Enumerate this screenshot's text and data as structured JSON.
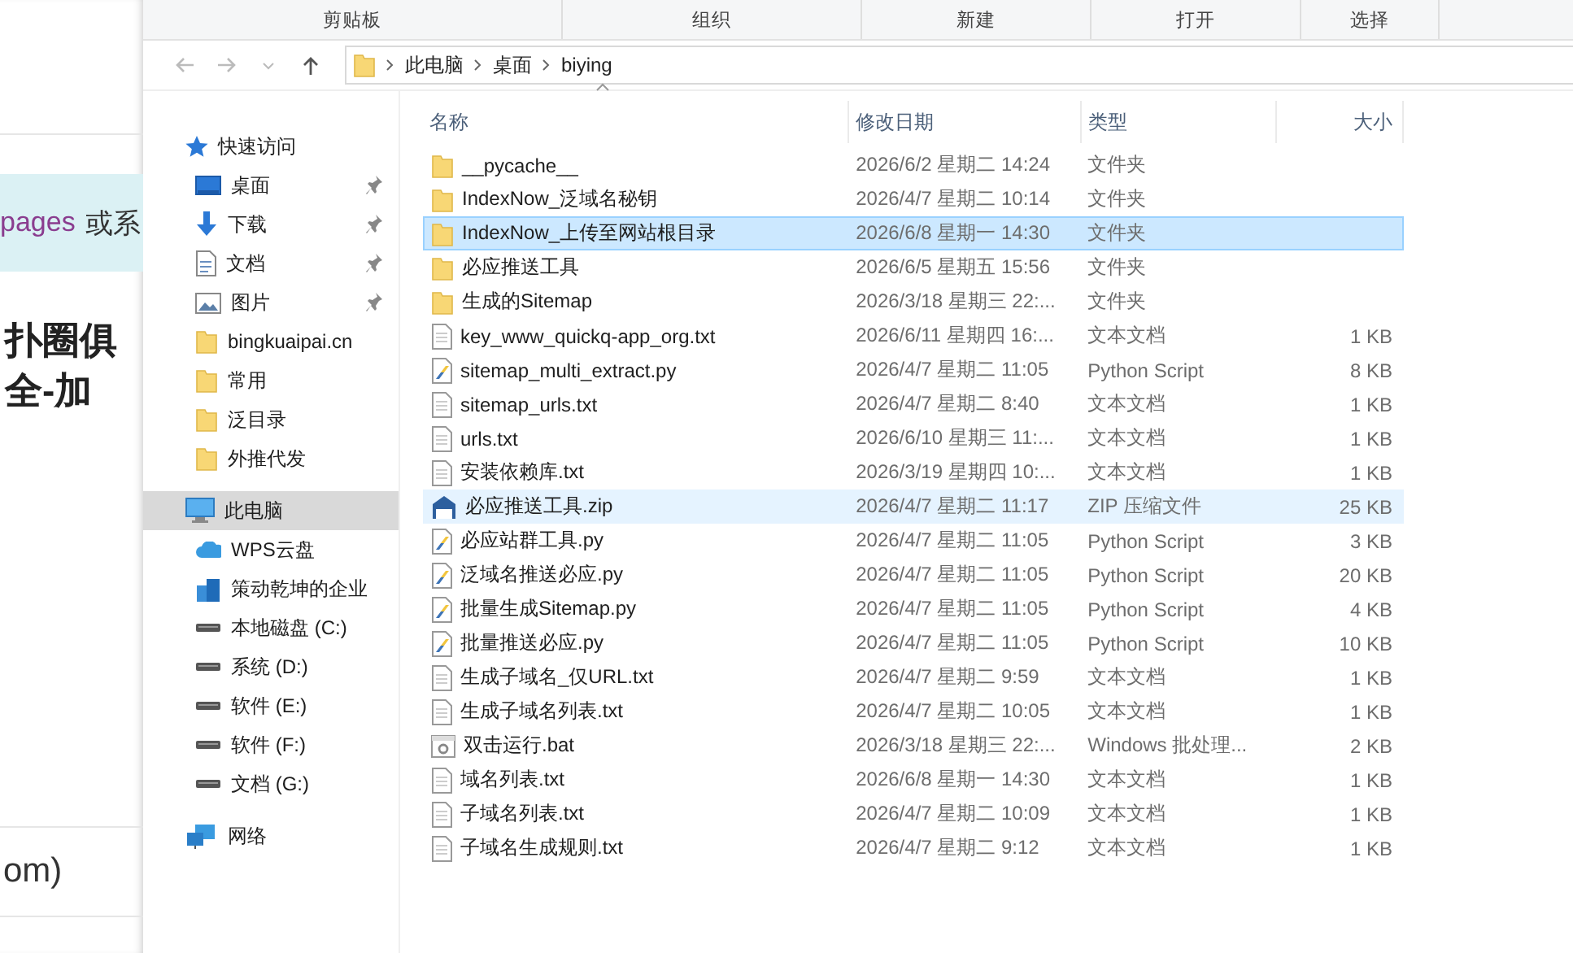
{
  "background_page": {
    "highlight_link": "pages",
    "highlight_text": "或系",
    "heading_lines": [
      "扑圈俱",
      "全-加"
    ],
    "footer_text": "om)"
  },
  "ribbon_groups": [
    "剪贴板",
    "组织",
    "新建",
    "打开",
    "选择"
  ],
  "address": {
    "crumbs": [
      "此电脑",
      "桌面",
      "biying"
    ]
  },
  "columns": [
    "名称",
    "修改日期",
    "类型",
    "大小"
  ],
  "nav": [
    {
      "kind": "star",
      "label": "快速访问",
      "selected": false,
      "pinned": false,
      "children": [
        {
          "kind": "desktop",
          "label": "桌面",
          "selected": false,
          "pinned": true
        },
        {
          "kind": "download",
          "label": "下载",
          "selected": false,
          "pinned": true
        },
        {
          "kind": "doc",
          "label": "文档",
          "selected": false,
          "pinned": true
        },
        {
          "kind": "picture",
          "label": "图片",
          "selected": false,
          "pinned": true
        },
        {
          "kind": "folder",
          "label": "bingkuaipai.cn",
          "selected": false,
          "pinned": false
        },
        {
          "kind": "folder",
          "label": "常用",
          "selected": false,
          "pinned": false
        },
        {
          "kind": "folder",
          "label": "泛目录",
          "selected": false,
          "pinned": false
        },
        {
          "kind": "folder",
          "label": "外推代发",
          "selected": false,
          "pinned": false
        }
      ]
    },
    {
      "kind": "pc",
      "label": "此电脑",
      "selected": true,
      "pinned": false,
      "children": [
        {
          "kind": "cloud",
          "label": "WPS云盘",
          "selected": false,
          "pinned": false
        },
        {
          "kind": "org",
          "label": "策动乾坤的企业",
          "selected": false,
          "pinned": false
        },
        {
          "kind": "drive",
          "label": "本地磁盘 (C:)",
          "selected": false,
          "pinned": false
        },
        {
          "kind": "drive",
          "label": "系统 (D:)",
          "selected": false,
          "pinned": false
        },
        {
          "kind": "drive",
          "label": "软件 (E:)",
          "selected": false,
          "pinned": false
        },
        {
          "kind": "drive",
          "label": "软件 (F:)",
          "selected": false,
          "pinned": false
        },
        {
          "kind": "drive",
          "label": "文档 (G:)",
          "selected": false,
          "pinned": false
        }
      ]
    },
    {
      "kind": "network",
      "label": "网络",
      "selected": false,
      "pinned": false
    }
  ],
  "files": [
    {
      "kind": "folder",
      "name": "__pycache__",
      "date": "2026/6/2 星期二 14:24",
      "type": "文件夹",
      "selected": false,
      "hovered": false
    },
    {
      "kind": "folder",
      "name": "IndexNow_泛域名秘钥",
      "date": "2026/4/7 星期二 10:14",
      "type": "文件夹",
      "selected": false,
      "hovered": false
    },
    {
      "kind": "folder",
      "name": "IndexNow_上传至网站根目录",
      "date": "2026/6/8 星期一 14:30",
      "type": "文件夹",
      "selected": true,
      "hovered": false
    },
    {
      "kind": "folder",
      "name": "必应推送工具",
      "date": "2026/6/5 星期五 15:56",
      "type": "文件夹",
      "selected": false,
      "hovered": false
    },
    {
      "kind": "folder",
      "name": "生成的Sitemap",
      "date": "2026/3/18 星期三 22:...",
      "type": "文件夹",
      "selected": false,
      "hovered": false
    },
    {
      "kind": "txt",
      "name": "key_www_quickq-app_org.txt",
      "date": "2026/6/11 星期四 16:...",
      "type": "文本文档",
      "size": "1 KB",
      "selected": false,
      "hovered": false
    },
    {
      "kind": "py",
      "name": "sitemap_multi_extract.py",
      "date": "2026/4/7 星期二 11:05",
      "type": "Python Script",
      "size": "8 KB",
      "selected": false,
      "hovered": false
    },
    {
      "kind": "txt",
      "name": "sitemap_urls.txt",
      "date": "2026/4/7 星期二 8:40",
      "type": "文本文档",
      "size": "1 KB",
      "selected": false,
      "hovered": false
    },
    {
      "kind": "txt",
      "name": "urls.txt",
      "date": "2026/6/10 星期三 11:...",
      "type": "文本文档",
      "size": "1 KB",
      "selected": false,
      "hovered": false
    },
    {
      "kind": "txt",
      "name": "安装依赖库.txt",
      "date": "2026/3/19 星期四 10:...",
      "type": "文本文档",
      "size": "1 KB",
      "selected": false,
      "hovered": false
    },
    {
      "kind": "zip",
      "name": "必应推送工具.zip",
      "date": "2026/4/7 星期二 11:17",
      "type": "ZIP 压缩文件",
      "size": "25 KB",
      "selected": false,
      "hovered": true
    },
    {
      "kind": "py",
      "name": "必应站群工具.py",
      "date": "2026/4/7 星期二 11:05",
      "type": "Python Script",
      "size": "3 KB",
      "selected": false,
      "hovered": false
    },
    {
      "kind": "py",
      "name": "泛域名推送必应.py",
      "date": "2026/4/7 星期二 11:05",
      "type": "Python Script",
      "size": "20 KB",
      "selected": false,
      "hovered": false
    },
    {
      "kind": "py",
      "name": "批量生成Sitemap.py",
      "date": "2026/4/7 星期二 11:05",
      "type": "Python Script",
      "size": "4 KB",
      "selected": false,
      "hovered": false
    },
    {
      "kind": "py",
      "name": "批量推送必应.py",
      "date": "2026/4/7 星期二 11:05",
      "type": "Python Script",
      "size": "10 KB",
      "selected": false,
      "hovered": false
    },
    {
      "kind": "txt",
      "name": "生成子域名_仅URL.txt",
      "date": "2026/4/7 星期二 9:59",
      "type": "文本文档",
      "size": "1 KB",
      "selected": false,
      "hovered": false
    },
    {
      "kind": "txt",
      "name": "生成子域名列表.txt",
      "date": "2026/4/7 星期二 10:05",
      "type": "文本文档",
      "size": "1 KB",
      "selected": false,
      "hovered": false
    },
    {
      "kind": "bat",
      "name": "双击运行.bat",
      "date": "2026/3/18 星期三 22:...",
      "type": "Windows 批处理...",
      "size": "2 KB",
      "selected": false,
      "hovered": false
    },
    {
      "kind": "txt",
      "name": "域名列表.txt",
      "date": "2026/6/8 星期一 14:30",
      "type": "文本文档",
      "size": "1 KB",
      "selected": false,
      "hovered": false
    },
    {
      "kind": "txt",
      "name": "子域名列表.txt",
      "date": "2026/4/7 星期二 10:09",
      "type": "文本文档",
      "size": "1 KB",
      "selected": false,
      "hovered": false
    },
    {
      "kind": "txt",
      "name": "子域名生成规则.txt",
      "date": "2026/4/7 星期二 9:12",
      "type": "文本文档",
      "size": "1 KB",
      "selected": false,
      "hovered": false
    }
  ]
}
